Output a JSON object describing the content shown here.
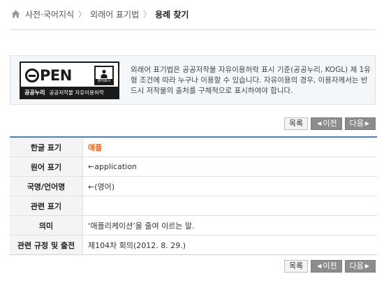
{
  "breadcrumb": {
    "home_icon": "home-icon",
    "items": [
      "사전·국어지식",
      "외래어 표기법",
      "용례 찾기"
    ],
    "separator": "〉"
  },
  "license": {
    "badge": {
      "open_text": "PEN",
      "cc_label": "출처표시",
      "footer_main": "공공누리",
      "footer_sub": "공공저작물 자유이용허락"
    },
    "text": "외래어 표기법은 공공저작물 자유이용허락 표시 기준(공공누리, KOGL) 제 1유형 조건에 따라 누구나 이용할 수 있습니다. 자유이용의 경우, 이용자께서는 반드시 저작물의 출처를 구체적으로 표시하여야 합니다."
  },
  "buttons": {
    "list_label": "목록",
    "prev_label": "이전",
    "next_label": "다음"
  },
  "details": {
    "rows": [
      {
        "label": "한글 표기",
        "value": "애플"
      },
      {
        "label": "원어 표기",
        "value": "←application"
      },
      {
        "label": "국명/언어명",
        "value": "←(영어)"
      },
      {
        "label": "관련 표기",
        "value": ""
      },
      {
        "label": "의미",
        "value": "‘애플리케이션’을 줄여 이르는 말."
      },
      {
        "label": "관련 규정 및 출전",
        "value": "제104차 회의(2012. 8. 29.)"
      }
    ]
  },
  "colors": {
    "accent_orange": "#e8661c",
    "table_rule_blue": "#4d7fc1",
    "button_gray": "#8c8c8c"
  }
}
